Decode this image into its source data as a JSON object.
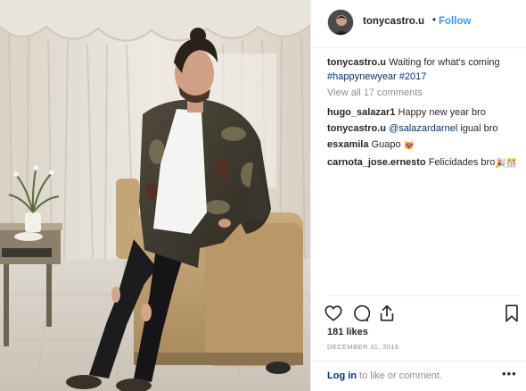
{
  "header": {
    "username": "tonycastro.u",
    "dot": "•",
    "follow_label": "Follow"
  },
  "caption": {
    "username": "tonycastro.u",
    "text": "Waiting for what's coming",
    "hashtags": [
      "#happynewyear",
      "#2017"
    ]
  },
  "view_all_comments": "View all 17 comments",
  "comments": [
    {
      "username": "hugo_salazar1",
      "mention": "",
      "text": "Happy new year bro",
      "emoji": ""
    },
    {
      "username": "tonycastro.u",
      "mention": "@salazardarnel",
      "text": "igual bro",
      "emoji": ""
    },
    {
      "username": "esxamila",
      "mention": "",
      "text": "Guapo",
      "emoji": "😻"
    },
    {
      "username": "carnota_jose.ernesto",
      "mention": "",
      "text": "Felicidades bro",
      "emoji": "🎉🎊"
    }
  ],
  "likes": "181 likes",
  "date": "DECEMBER 31, 2016",
  "footer": {
    "login_label": "Log in",
    "rest": " to like or comment.",
    "more": "•••"
  },
  "icons": {
    "like": "heart-outline-icon",
    "comment": "comment-bubble-icon",
    "share": "share-icon",
    "save": "bookmark-icon",
    "more": "more-options-icon"
  },
  "colors": {
    "link_blue": "#3897f0",
    "hashtag_navy": "#003569",
    "muted_gray": "#8e8e8e",
    "text": "#262626"
  }
}
